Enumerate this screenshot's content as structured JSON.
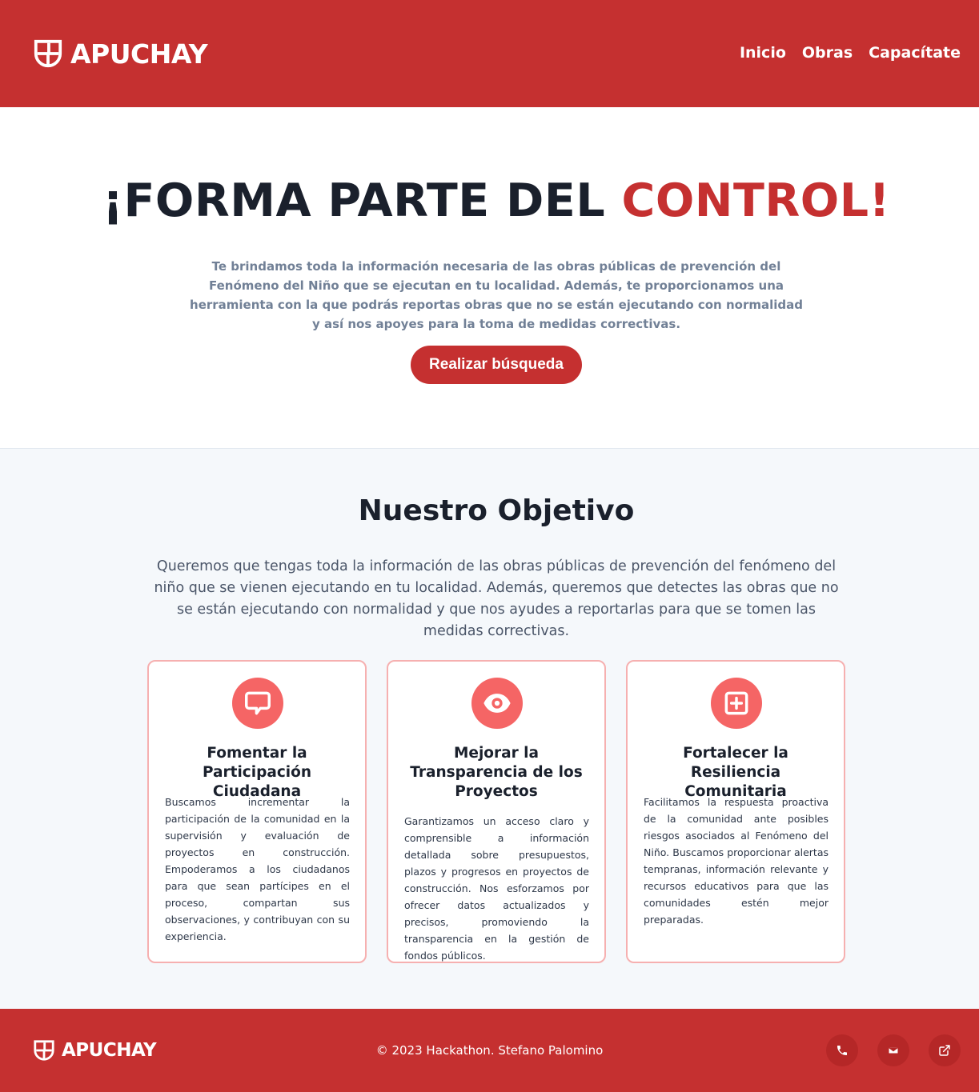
{
  "header": {
    "brand": "APUCHAY",
    "nav": [
      "Inicio",
      "Obras",
      "Capacítate"
    ]
  },
  "hero": {
    "title_main": "¡FORMA PARTE DEL ",
    "title_accent": "CONTROL!",
    "description": "Te brindamos toda la información necesaria de las obras públicas de prevención del Fenómeno del Niño que se ejecutan en tu localidad. Además, te proporcionamos una herramienta con la que podrás reportas obras que no se están ejecutando con normalidad y así nos apoyes para la toma de medidas correctivas.",
    "button": "Realizar búsqueda"
  },
  "objetivo": {
    "title": "Nuestro Objetivo",
    "description": "Queremos que tengas toda la información de las obras públicas de prevención del fenómeno del niño que se vienen ejecutando en tu localidad. Además, queremos que detectes las obras que no se están ejecutando con normalidad y que nos ayudes a reportarlas para que se tomen las medidas correctivas.",
    "cards": [
      {
        "icon": "chat-bubble-icon",
        "title": "Fomentar la Participación Ciudadana",
        "text": "Buscamos incrementar la participación de la comunidad en la supervisión y evaluación de proyectos en construcción. Empoderamos a los ciudadanos para que sean partícipes en el proceso, compartan sus observaciones, y contribuyan con su experiencia."
      },
      {
        "icon": "eye-icon",
        "title": "Mejorar la Transparencia de los Proyectos",
        "text": "Garantizamos un acceso claro y comprensible a información detallada sobre presupuestos, plazos y progresos en proyectos de construcción. Nos esforzamos por ofrecer datos actualizados y precisos, promoviendo la transparencia en la gestión de fondos públicos."
      },
      {
        "icon": "plus-square-icon",
        "title": "Fortalecer la Resiliencia Comunitaria",
        "text": "Facilitamos la respuesta proactiva de la comunidad ante posibles riesgos asociados al Fenómeno del Niño. Buscamos proporcionar alertas tempranas, información relevante y recursos educativos para que las comunidades estén mejor preparadas."
      }
    ]
  },
  "footer": {
    "brand": "APUCHAY",
    "copyright": "© 2023 Hackathon. Stefano Palomino",
    "icons": [
      "phone-icon",
      "mail-icon",
      "external-link-icon"
    ]
  },
  "colors": {
    "primary": "#c53030",
    "icon_circle": "#f56565",
    "card_border": "#f6b0b0",
    "section_bg": "#f5f8fb"
  }
}
